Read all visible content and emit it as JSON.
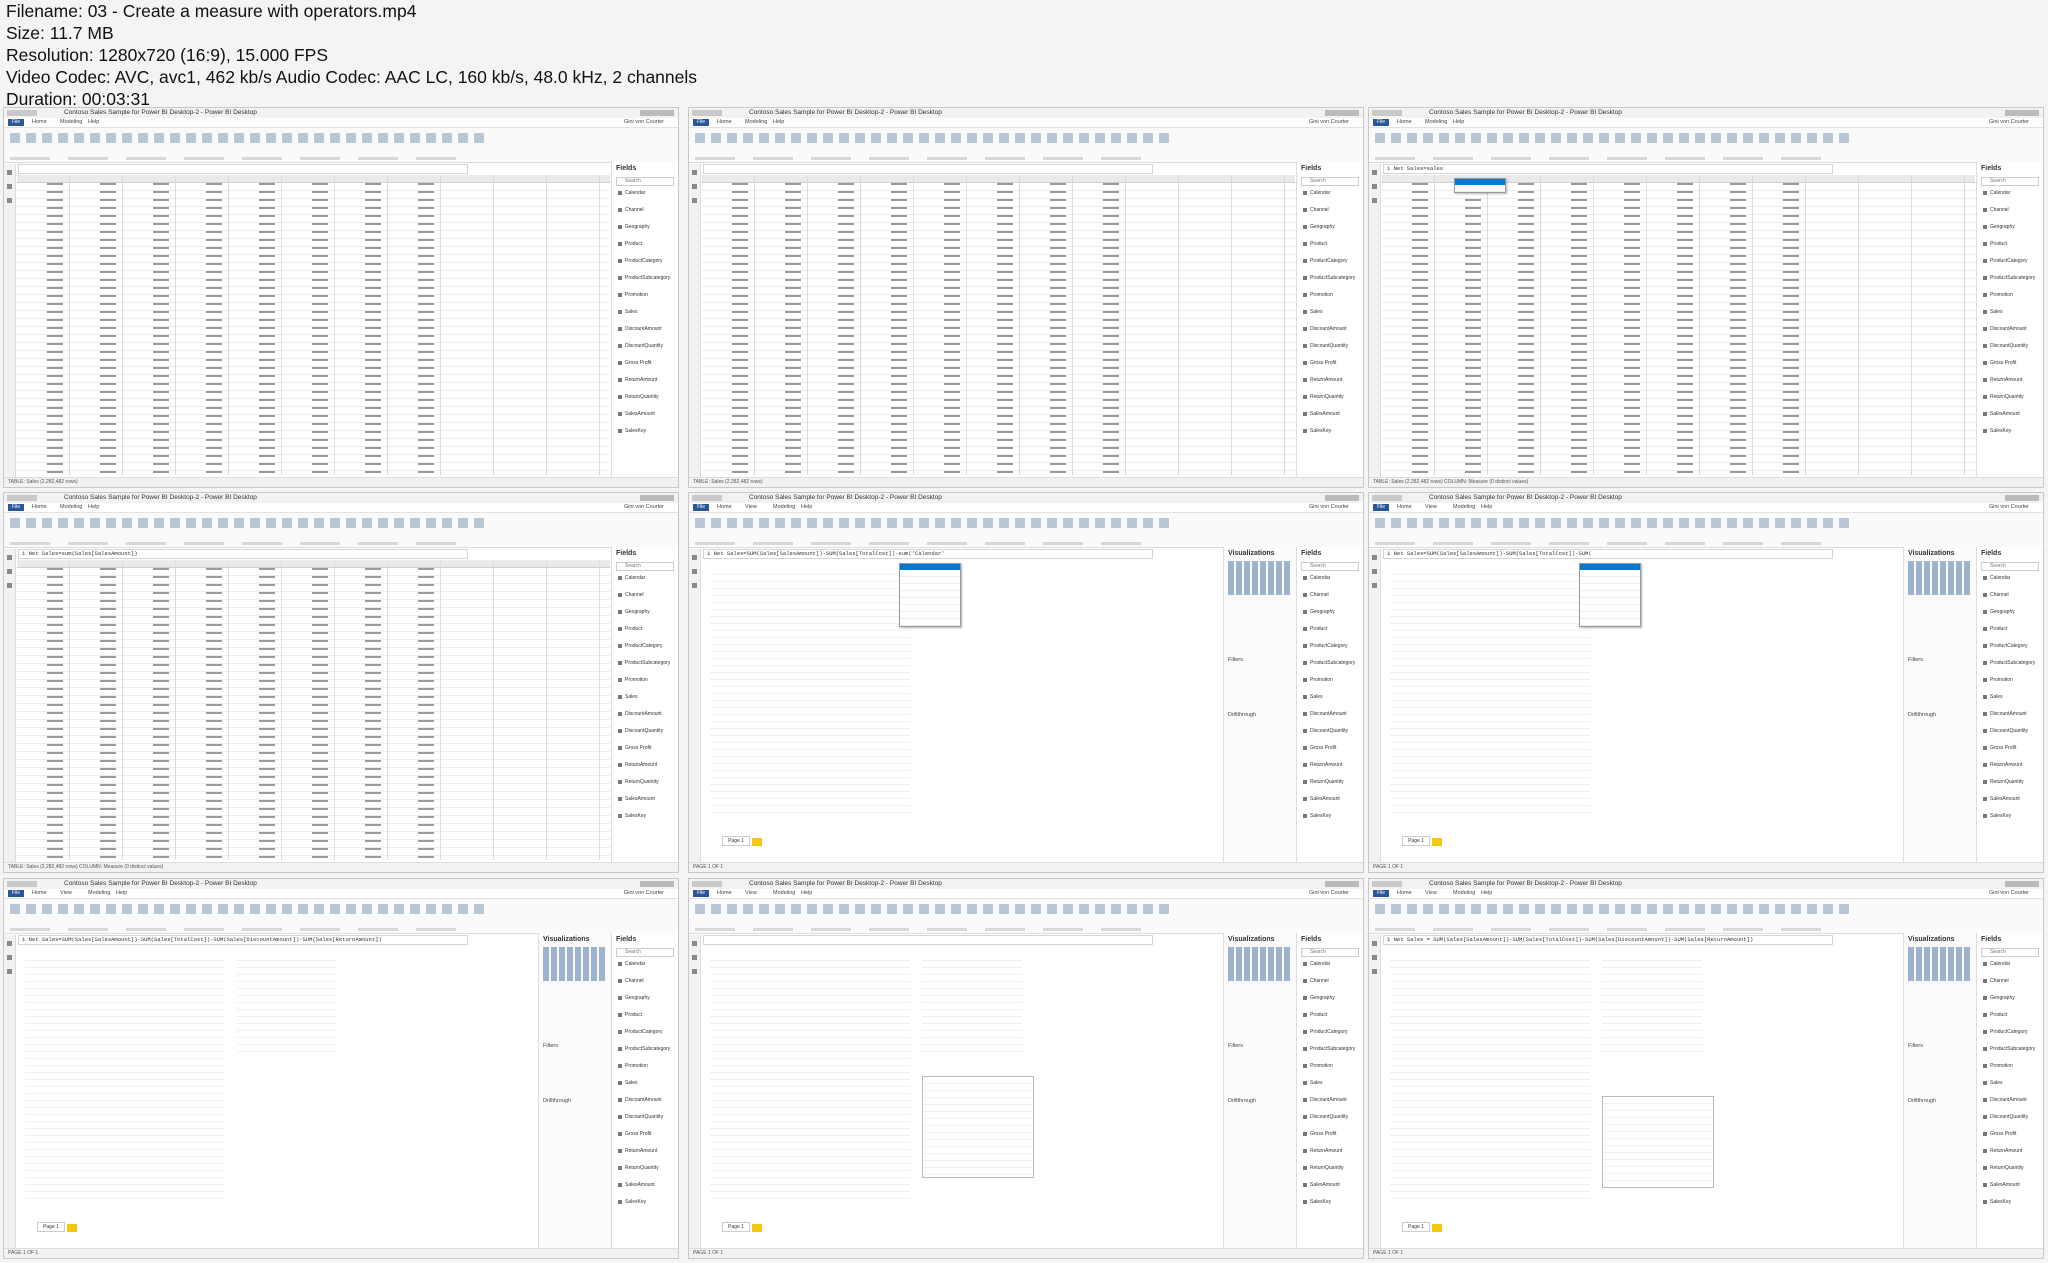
{
  "file_info": [
    "Filename: 03 - Create a measure with operators.mp4",
    "Size: 11.7 MB",
    "Resolution: 1280x720 (16:9), 15.000 FPS",
    "Video Codec: AVC, avc1, 462 kb/s Audio Codec: AAC LC, 160 kb/s, 48.0 kHz, 2 channels",
    "Duration: 00:03:31"
  ],
  "app": {
    "title": "Contoso Sales Sample for Power BI Desktop-2 - Power BI Desktop",
    "user": "Gini von Courter",
    "file_tab": "File",
    "tabs": [
      "Home",
      "Modeling",
      "Help"
    ],
    "tabs_report": [
      "Home",
      "View",
      "Modeling",
      "Help"
    ],
    "fields_title": "Fields",
    "viz_title": "Visualizations",
    "search": "Search",
    "filters": "Filters",
    "drillthrough": "Drillthrough",
    "page_tab": "Page 1"
  },
  "fields_list": [
    "Calendar",
    "Channel",
    "Geography",
    "Product",
    "ProductCategory",
    "ProductSubcategory",
    "Promotion",
    "Sales",
    "DiscountAmount",
    "DiscountQuantity",
    "Gross Profit",
    "ReturnAmount",
    "ReturnQuantity",
    "SalesAmount",
    "SalesKey"
  ],
  "thumbs": [
    {
      "mode": "data",
      "formula": "",
      "status": "TABLE: Sales (2,282,482 rows)"
    },
    {
      "mode": "data",
      "formula": "",
      "status": "TABLE: Sales (2,282,482 rows)"
    },
    {
      "mode": "data",
      "formula": "1 Net Sales=sales",
      "status": "TABLE: Sales (2,282,482 rows) COLUMN: Measure (0 distinct values)",
      "popup": true
    },
    {
      "mode": "data",
      "formula": "1 Net Sales=sum(Sales[SalesAmount])",
      "status": "TABLE: Sales (2,282,482 rows) COLUMN: Measure (0 distinct values)"
    },
    {
      "mode": "report",
      "formula": "1 Net Sales=SUM(Sales[SalesAmount])-SUM(Sales[TotalCost])-sum('Calendar'",
      "status": "PAGE 1 OF 1",
      "popup": true
    },
    {
      "mode": "report",
      "formula": "1 Net Sales=SUM(Sales[SalesAmount])-SUM(Sales[TotalCost])-SUM(",
      "status": "PAGE 1 OF 1",
      "popup": true
    },
    {
      "mode": "report",
      "formula": "1 Net Sales=SUM(Sales[SalesAmount])-SUM(Sales[TotalCost])-SUM(Sales[DiscountAmount])-SUM(Sales[ReturnAmount])",
      "status": "PAGE 1 OF 1",
      "second_table": true
    },
    {
      "mode": "report",
      "formula": "",
      "status": "PAGE 1 OF 1",
      "second_table": true,
      "empty_visual": true
    },
    {
      "mode": "report",
      "formula": "1 Net Sales = SUM(Sales[SalesAmount])-SUM(Sales[TotalCost])-SUM(Sales[DiscountAmount])-SUM(Sales[ReturnAmount])",
      "status": "PAGE 1 OF 1",
      "second_table": true,
      "third_table": true
    }
  ]
}
